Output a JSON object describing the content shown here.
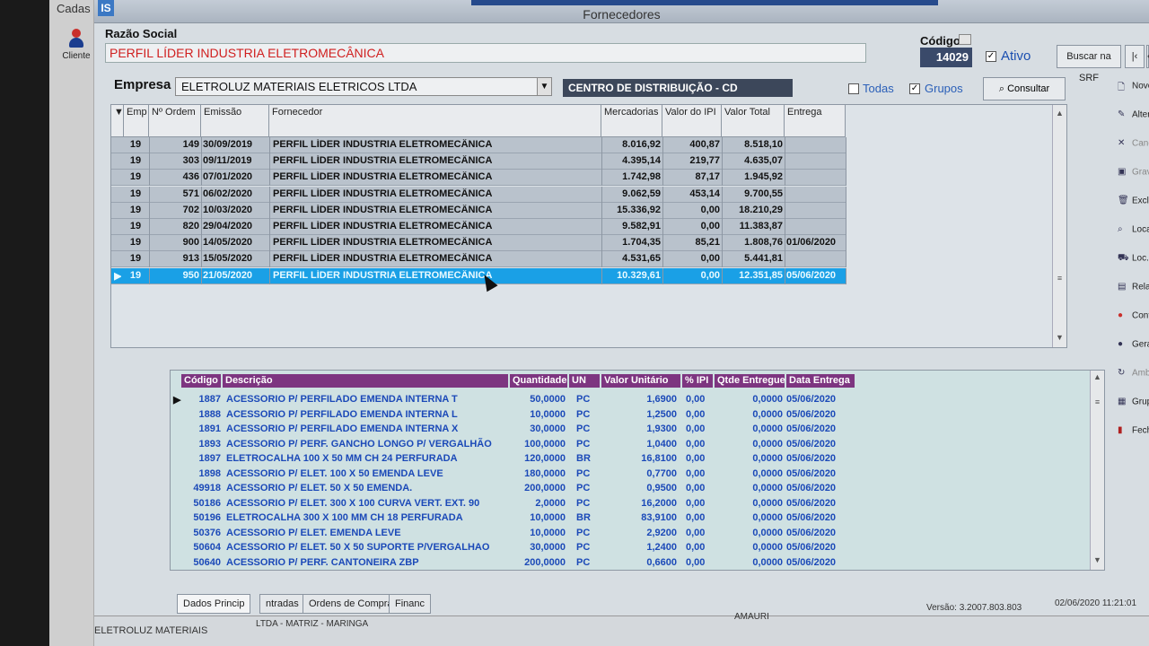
{
  "left_strip": {
    "menu": "Cadas",
    "client_label": "Cliente"
  },
  "window": {
    "app_icon": "IS",
    "title": "Fornecedores"
  },
  "header": {
    "razao_label": "Razão Social",
    "razao_value": "PERFIL LÍDER INDUSTRIA ELETROMECÂNICA",
    "codigo_label": "Código",
    "codigo_value": "14029",
    "ativo_label": "Ativo",
    "ativo_checked": "✓",
    "buscar_label": "Buscar na SRF",
    "nav_first": "|‹",
    "nav_prev": "‹",
    "nav_next": "›"
  },
  "filter": {
    "empresa_label": "Empresa",
    "empresa_value": "ELETROLUZ MATERIAIS ELETRICOS LTDA",
    "cd_value": "CENTRO DE DISTRIBUIÇÃO - CD",
    "todas_label": "Todas",
    "grupos_label": "Grupos",
    "grupos_checked": "✓",
    "consultar_label": "Consultar"
  },
  "orders": {
    "columns": [
      "Emp",
      "Nº Ordem",
      "Emissão",
      "Fornecedor",
      "Mercadorias",
      "Valor do IPI",
      "Valor Total",
      "Entrega"
    ],
    "rows": [
      [
        "19",
        "149",
        "30/09/2019",
        "PERFIL LÍDER INDUSTRIA ELETROMECÂNICA",
        "8.016,92",
        "400,87",
        "8.518,10",
        ""
      ],
      [
        "19",
        "303",
        "09/11/2019",
        "PERFIL LÍDER INDUSTRIA ELETROMECÂNICA",
        "4.395,14",
        "219,77",
        "4.635,07",
        ""
      ],
      [
        "19",
        "436",
        "07/01/2020",
        "PERFIL LÍDER INDUSTRIA ELETROMECÂNICA",
        "1.742,98",
        "87,17",
        "1.945,92",
        ""
      ],
      [
        "19",
        "571",
        "06/02/2020",
        "PERFIL LÍDER INDUSTRIA ELETROMECÂNICA",
        "9.062,59",
        "453,14",
        "9.700,55",
        ""
      ],
      [
        "19",
        "702",
        "10/03/2020",
        "PERFIL LÍDER INDUSTRIA ELETROMECÂNICA",
        "15.336,92",
        "0,00",
        "18.210,29",
        ""
      ],
      [
        "19",
        "820",
        "29/04/2020",
        "PERFIL LÍDER INDUSTRIA ELETROMECÂNICA",
        "9.582,91",
        "0,00",
        "11.383,87",
        ""
      ],
      [
        "19",
        "900",
        "14/05/2020",
        "PERFIL LÍDER INDUSTRIA ELETROMECÂNICA",
        "1.704,35",
        "85,21",
        "1.808,76",
        "01/06/2020"
      ],
      [
        "19",
        "913",
        "15/05/2020",
        "PERFIL LÍDER INDUSTRIA ELETROMECÂNICA",
        "4.531,65",
        "0,00",
        "5.441,81",
        ""
      ],
      [
        "19",
        "950",
        "21/05/2020",
        "PERFIL LÍDER INDUSTRIA ELETROMECÂNICA",
        "10.329,61",
        "0,00",
        "12.351,85",
        "05/06/2020"
      ]
    ]
  },
  "items": {
    "columns": [
      "Código",
      "Descrição",
      "Quantidade",
      "UN",
      "Valor Unitário",
      "% IPI",
      "Qtde Entregue",
      "Data Entrega"
    ],
    "rows": [
      [
        "1887",
        "ACESSORIO P/ PERFILADO EMENDA INTERNA T",
        "50,0000",
        "PC",
        "1,6900",
        "0,00",
        "0,0000",
        "05/06/2020"
      ],
      [
        "1888",
        "ACESSORIO P/ PERFILADO EMENDA INTERNA L",
        "10,0000",
        "PC",
        "1,2500",
        "0,00",
        "0,0000",
        "05/06/2020"
      ],
      [
        "1891",
        "ACESSORIO P/ PERFILADO EMENDA INTERNA X",
        "30,0000",
        "PC",
        "1,9300",
        "0,00",
        "0,0000",
        "05/06/2020"
      ],
      [
        "1893",
        "ACESSORIO P/ PERF. GANCHO LONGO P/ VERGALHÃO",
        "100,0000",
        "PC",
        "1,0400",
        "0,00",
        "0,0000",
        "05/06/2020"
      ],
      [
        "1897",
        "ELETROCALHA 100 X  50 MM CH 24 PERFURADA",
        "120,0000",
        "BR",
        "16,8100",
        "0,00",
        "0,0000",
        "05/06/2020"
      ],
      [
        "1898",
        "ACESSORIO P/ ELET. 100 X  50 EMENDA LEVE",
        "180,0000",
        "PC",
        "0,7700",
        "0,00",
        "0,0000",
        "05/06/2020"
      ],
      [
        "49918",
        "ACESSORIO P/ ELET.  50 X  50 EMENDA.",
        "200,0000",
        "PC",
        "0,9500",
        "0,00",
        "0,0000",
        "05/06/2020"
      ],
      [
        "50186",
        "ACESSORIO P/ ELET. 300 X 100 CURVA VERT. EXT. 90",
        "2,0000",
        "PC",
        "16,2000",
        "0,00",
        "0,0000",
        "05/06/2020"
      ],
      [
        "50196",
        "ELETROCALHA 300 X 100 MM CH 18 PERFURADA",
        "10,0000",
        "BR",
        "83,9100",
        "0,00",
        "0,0000",
        "05/06/2020"
      ],
      [
        "50376",
        "ACESSORIO P/ ELET. EMENDA LEVE",
        "10,0000",
        "PC",
        "2,9200",
        "0,00",
        "0,0000",
        "05/06/2020"
      ],
      [
        "50604",
        "ACESSORIO P/ ELET.  50 X  50 SUPORTE P/VERGALHAO",
        "30,0000",
        "PC",
        "1,2400",
        "0,00",
        "0,0000",
        "05/06/2020"
      ],
      [
        "50640",
        "ACESSORIO P/ PERF. CANTONEIRA ZBP",
        "200,0000",
        "PC",
        "0,6600",
        "0,00",
        "0,0000",
        "05/06/2020"
      ]
    ]
  },
  "tabs": [
    "Dados Princip",
    "ntradas",
    "Ordens de Compra",
    "Financ"
  ],
  "status": {
    "company": "ELETROLUZ MATERIAIS",
    "company_tail": "LTDA  -  MATRIZ - MARINGA",
    "user": "AMAURI",
    "version": "Versão: 3.2007.803.803",
    "datetime": "02/06/2020 11:21:01"
  },
  "sidebar": [
    {
      "label": "Novo",
      "icon": "new-doc-icon",
      "enabled": true
    },
    {
      "label": "Alterar",
      "icon": "edit-icon",
      "enabled": true
    },
    {
      "label": "Cancelar",
      "icon": "cancel-icon",
      "enabled": false
    },
    {
      "label": "Gravar",
      "icon": "save-icon",
      "enabled": false
    },
    {
      "label": "Excluir",
      "icon": "trash-icon",
      "enabled": true
    },
    {
      "label": "Localizar",
      "icon": "search-icon",
      "enabled": true
    },
    {
      "label": "Loc. Transportador",
      "icon": "truck-icon",
      "enabled": true
    },
    {
      "label": "Relatórios",
      "icon": "report-icon",
      "enabled": true
    },
    {
      "label": "Contatos",
      "icon": "contacts-icon",
      "enabled": true
    },
    {
      "label": "Gerar Cliente",
      "icon": "user-add-icon",
      "enabled": true
    },
    {
      "label": "Amb. Reposição",
      "icon": "refresh-icon",
      "enabled": false
    },
    {
      "label": "Grupos",
      "icon": "groups-icon",
      "enabled": true
    },
    {
      "label": "Fechar",
      "icon": "close-door-icon",
      "enabled": true
    }
  ],
  "colors": {
    "accent": "#1aa0e6",
    "title_red": "#d02020",
    "header_purple": "#7d3580",
    "item_blue": "#1b49b8"
  }
}
